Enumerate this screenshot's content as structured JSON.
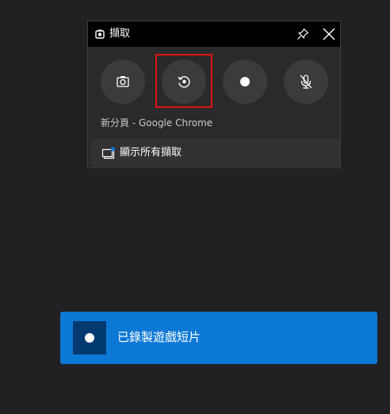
{
  "capture_widget": {
    "title": "擷取",
    "icons": {
      "title": "xbox-game-bar-capture-icon",
      "pin": "pin-icon",
      "close": "close-icon"
    },
    "buttons": [
      {
        "name": "screenshot",
        "icon": "camera-icon"
      },
      {
        "name": "record-last-30-sec",
        "icon": "record-last-icon",
        "highlighted": true
      },
      {
        "name": "start-recording",
        "icon": "record-dot-icon"
      },
      {
        "name": "mic-toggle",
        "icon": "mic-off-icon"
      }
    ],
    "app_name": "新分頁 - Google Chrome",
    "show_all_label": "顯示所有擷取",
    "show_all_icon": "gallery-icon"
  },
  "toast": {
    "message": "已錄製遊戲短片",
    "icon": "record-dot-icon",
    "color": "#0c78d6"
  },
  "colors": {
    "background": "#212124",
    "highlight": "#e01212"
  }
}
